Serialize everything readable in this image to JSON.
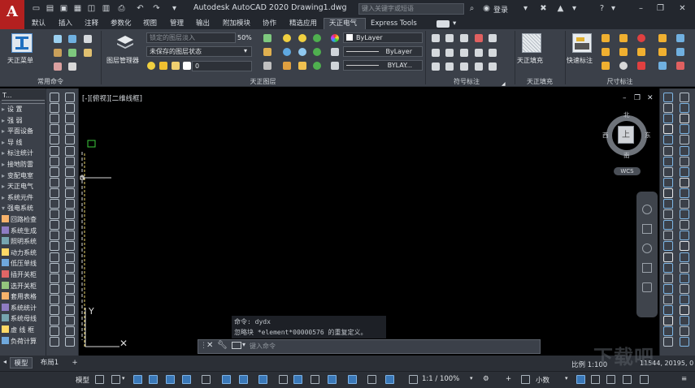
{
  "app": {
    "logo_letter": "A",
    "title": "Autodesk AutoCAD 2020    Drawing1.dwg",
    "search_placeholder": "键入关键字或短语",
    "login_label": "登录"
  },
  "ribbon_tabs": [
    "默认",
    "插入",
    "注释",
    "参数化",
    "视图",
    "管理",
    "输出",
    "附加模块",
    "协作",
    "精选应用",
    "天正电气",
    "Express Tools"
  ],
  "active_tab": "天正电气",
  "ribbon": {
    "groups": [
      {
        "title": "常用命令",
        "big_label": "天正菜单"
      },
      {
        "title": "天正图层",
        "big_label": "图层管理器"
      },
      {
        "title": "符号标注"
      },
      {
        "title": "天正填充",
        "big_label": "天正填充"
      },
      {
        "title": "尺寸标注",
        "big_label": "快速标注"
      }
    ],
    "layer_lock_value": "锁定的图层淡入",
    "layer_lock_percent": "50%",
    "layer_state": "未保存的图层状态",
    "current_layer": "0",
    "prop_color": "ByLayer",
    "prop_linetype": "ByLayer",
    "prop_lineweight": "BYLAY..."
  },
  "left_panel": {
    "header": "T...",
    "items": [
      {
        "label": "设    置",
        "arrow": "▸"
      },
      {
        "label": "强    弱",
        "arrow": "▸"
      },
      {
        "label": "平面设备",
        "arrow": "▸"
      },
      {
        "label": "导    线",
        "arrow": "▸"
      },
      {
        "label": "标注统计",
        "arrow": "▸"
      },
      {
        "label": "接地防雷",
        "arrow": "▸"
      },
      {
        "label": "变配电室",
        "arrow": "▸"
      },
      {
        "label": "天正电气",
        "arrow": "▸"
      },
      {
        "label": "系统元件",
        "arrow": "▸"
      },
      {
        "label": "强电系统",
        "arrow": "▾"
      },
      {
        "label": "回路检查",
        "arrow": ""
      },
      {
        "label": "系统生成",
        "arrow": ""
      },
      {
        "label": "照明系统",
        "arrow": ""
      },
      {
        "label": "动力系统",
        "arrow": ""
      },
      {
        "label": "低压单线",
        "arrow": ""
      },
      {
        "label": "插开关柜",
        "arrow": ""
      },
      {
        "label": "选开关柜",
        "arrow": ""
      },
      {
        "label": "套用表格",
        "arrow": ""
      },
      {
        "label": "系统统计",
        "arrow": ""
      },
      {
        "label": "系统母线",
        "arrow": ""
      },
      {
        "label": "虚 线 框",
        "arrow": ""
      },
      {
        "label": "负荷计算",
        "arrow": ""
      }
    ]
  },
  "canvas": {
    "viewport_label": "[-][俯视][二维线框]",
    "compass": {
      "north": "北",
      "south": "南",
      "east": "东",
      "west": "西",
      "face": "上"
    },
    "wcs": "WCS",
    "axis_y": "Y"
  },
  "command": {
    "history": [
      "命令: dydx",
      "忽略块 *element*00000576 的重复定义。"
    ],
    "input_placeholder": "键入命令"
  },
  "layout_tabs": [
    "模型",
    "布局1"
  ],
  "status": {
    "scale": "比例 1:100",
    "coords": "11544, 20195, 0",
    "model_label": "模型",
    "annotation_scale": "1:1 / 100%",
    "units": "小数"
  },
  "watermark": "下载吧"
}
